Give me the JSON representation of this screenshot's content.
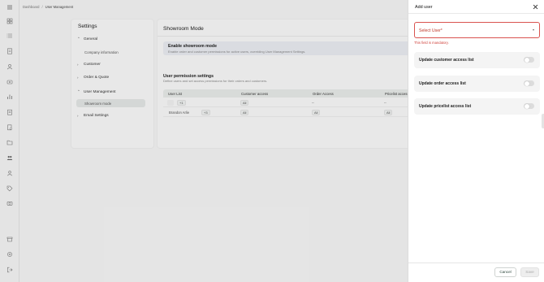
{
  "breadcrumb": {
    "root": "Dashboard",
    "separator": "/",
    "current": "User Management"
  },
  "rail_icons": [
    "menu-icon",
    "grid-icon",
    "list-icon",
    "document-icon",
    "user-icon",
    "tag-icon",
    "bar-chart-icon",
    "clipboard-icon",
    "document-search-icon",
    "folder-icon",
    "team-icon",
    "person-icon",
    "price-tag-icon",
    "camera-icon",
    "storefront-icon",
    "settings-icon",
    "logout-icon"
  ],
  "settings": {
    "title": "Settings",
    "general": {
      "label": "General",
      "expanded": true,
      "children": [
        "Company information"
      ]
    },
    "customer": "Customer",
    "order_quote": "Order & Quote",
    "user_management": {
      "label": "User Management",
      "expanded": true,
      "children": [
        "Showroom mode"
      ]
    },
    "email_settings": "Email Settings"
  },
  "main": {
    "title": "Showroom Mode",
    "banner": {
      "title": "Enable showroom mode",
      "description": "Enable order and customer permissions for active users, overriding User Management Settings."
    },
    "permissions": {
      "title": "User permission settings",
      "description": "Define users and set access permissions for their orders and customers.",
      "columns": [
        "User List",
        "Customer access",
        "Order Access",
        "Pricelist access"
      ],
      "rows": [
        {
          "user": "",
          "extra": "+1",
          "customer": "All",
          "order": "--",
          "pricelist": "--"
        },
        {
          "user": "Brandon Arlie",
          "extra": "+3",
          "customer": "All",
          "order": "All",
          "pricelist": "All"
        }
      ]
    }
  },
  "drawer": {
    "title": "Add user",
    "select_placeholder": "Select User*",
    "error": "This field is mandatory.",
    "toggles": [
      {
        "label": "Update customer access list",
        "on": false
      },
      {
        "label": "Update order access list",
        "on": false
      },
      {
        "label": "Update pricelist access list",
        "on": false
      }
    ],
    "cancel_label": "Cancel",
    "save_label": "Save"
  },
  "colors": {
    "error": "#d0443e",
    "panel": "#f7f7f7",
    "banner": "#e8eaf0",
    "cancel_text": "#1f3b2f"
  }
}
